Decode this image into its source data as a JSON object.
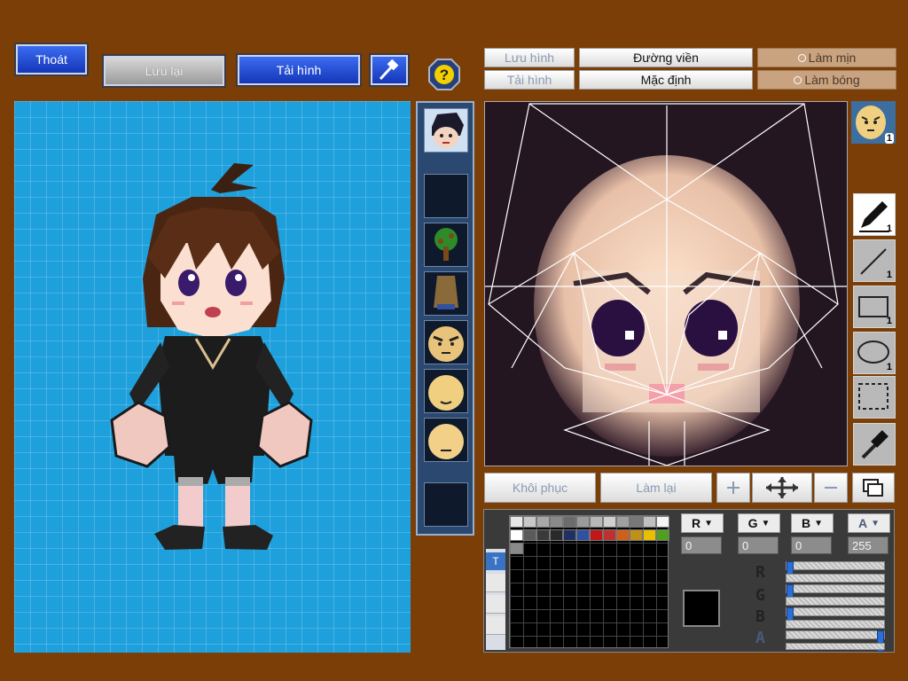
{
  "top_bar": {
    "exit_label": "Thoát",
    "save_label": "Lưu lại",
    "load_label": "Tải hình",
    "tool_icon": "hammer-icon",
    "help_icon": "help-icon"
  },
  "editor_bar": {
    "save_image_label": "Lưu hình",
    "load_image_label": "Tải hình",
    "outline_label": "Đường viền",
    "default_label": "Mặc định",
    "smooth_label": "Làm mịn",
    "shine_label": "Làm bóng"
  },
  "tools": {
    "pen_count": "1",
    "line_count": "1",
    "rect_count": "1",
    "ellipse_count": "1",
    "preview_count": "1"
  },
  "bottom_bar": {
    "restore_label": "Khôi phục",
    "redo_label": "Làm lại"
  },
  "color": {
    "r_label": "R",
    "g_label": "G",
    "b_label": "B",
    "a_label": "A",
    "r_value": "0",
    "g_value": "0",
    "b_value": "0",
    "a_value": "255",
    "r_level": 0,
    "g_level": 0,
    "b_level": 0,
    "a_level": 1.0,
    "current": "#000000",
    "palette": [
      "#e8e8e8",
      "#c8c8c8",
      "#a8a8a8",
      "#8a8a8a",
      "#6c6c6c",
      "#9a9a9a",
      "#b8b8b8",
      "#d0d0d0",
      "#a0a0a0",
      "#787878",
      "#c0c0c0",
      "#f4f4f4",
      "#ffffff",
      "#5a5a5a",
      "#3a3a3a",
      "#2a2a2a",
      "#203060",
      "#3050a0",
      "#c01818",
      "#c03030",
      "#d06018",
      "#c09018",
      "#e8c000",
      "#50a020",
      "#8a8a8a"
    ]
  },
  "parts_panel": {
    "slots": [
      "face-icon",
      "empty-slot",
      "tree-icon",
      "body-icon",
      "eyebrows-icon",
      "mouth-icon",
      "face-base-icon",
      "empty-slot"
    ]
  }
}
